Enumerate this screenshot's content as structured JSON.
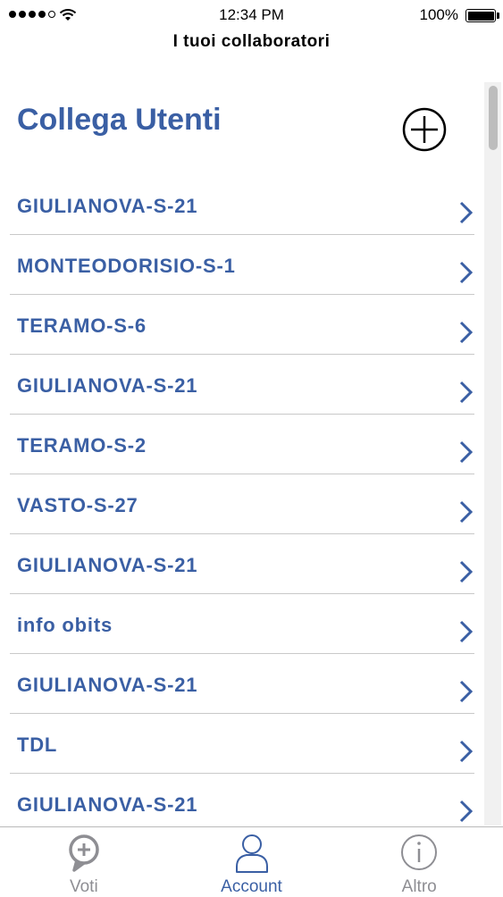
{
  "status_bar": {
    "time": "12:34 PM",
    "battery": "100%",
    "signal_icon": "signal-dots-icon",
    "wifi_icon": "wifi-icon",
    "battery_icon": "battery-icon"
  },
  "nav": {
    "title": "I tuoi collaboratori"
  },
  "section": {
    "title": "Collega Utenti",
    "add_icon": "plus-circle-icon"
  },
  "list": {
    "items": [
      {
        "label": "GIULIANOVA-S-21"
      },
      {
        "label": "MONTEODORISIO-S-1"
      },
      {
        "label": "TERAMO-S-6"
      },
      {
        "label": "GIULIANOVA-S-21"
      },
      {
        "label": "TERAMO-S-2"
      },
      {
        "label": "VASTO-S-27"
      },
      {
        "label": "GIULIANOVA-S-21"
      },
      {
        "label": "info obits"
      },
      {
        "label": "GIULIANOVA-S-21"
      },
      {
        "label": "TDL"
      },
      {
        "label": "GIULIANOVA-S-21"
      }
    ],
    "chevron_icon": "chevron-right-icon"
  },
  "tab_bar": {
    "tabs": [
      {
        "label": "Voti",
        "icon": "speech-bubble-plus-icon",
        "active": false
      },
      {
        "label": "Account",
        "icon": "person-icon",
        "active": true
      },
      {
        "label": "Altro",
        "icon": "info-circle-icon",
        "active": false
      }
    ]
  },
  "colors": {
    "accent": "#3a5fa4",
    "inactive": "#8e8e93",
    "divider": "#c9c9c9"
  }
}
